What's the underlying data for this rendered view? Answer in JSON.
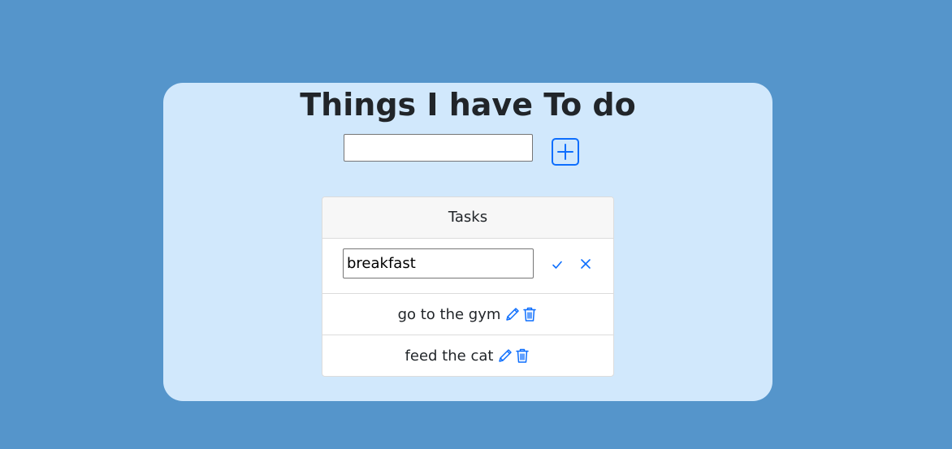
{
  "title": "Things I have To do",
  "new_task": {
    "value": "",
    "placeholder": ""
  },
  "tasks_header": "Tasks",
  "editing": {
    "value": "breakfast"
  },
  "tasks": [
    {
      "text": "go to the gym"
    },
    {
      "text": "feed the cat"
    }
  ],
  "icons": {
    "add": "plus-square-icon",
    "confirm": "check-icon",
    "cancel": "x-icon",
    "edit": "pencil-icon",
    "delete": "trash-icon"
  },
  "colors": {
    "background": "#5595cb",
    "card": "#d1e8fc",
    "accent": "#0d6efd"
  }
}
